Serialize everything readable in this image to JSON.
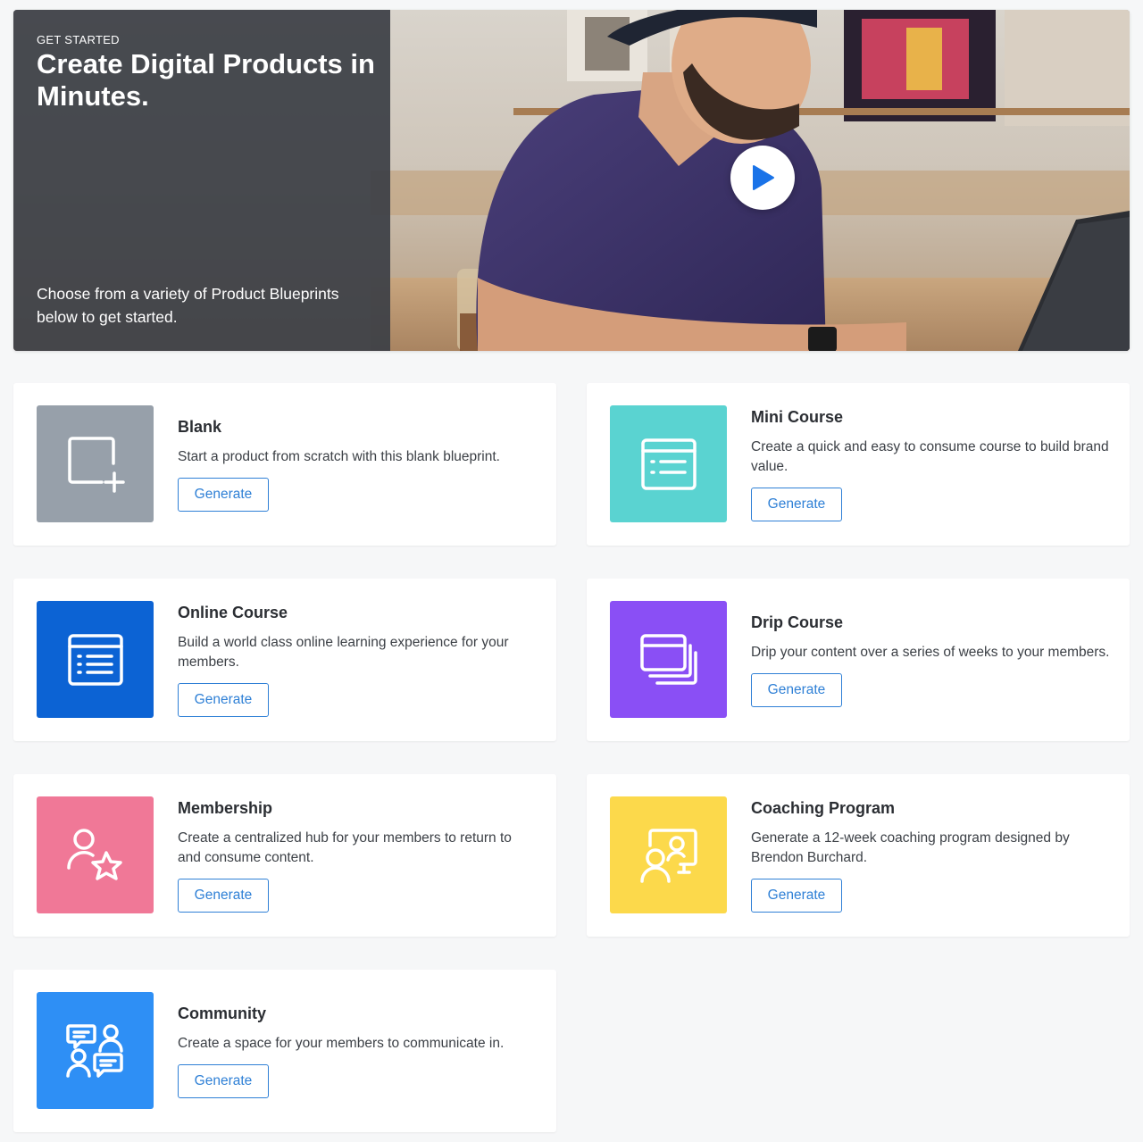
{
  "hero": {
    "eyebrow": "GET STARTED",
    "title": "Create Digital Products in Minutes.",
    "description": "Choose from a variety of Product Blueprints below to get started.",
    "play_icon": "play-icon"
  },
  "cards": [
    {
      "title": "Blank",
      "description": "Start a product from scratch with this blank blueprint.",
      "button_label": "Generate",
      "icon": "blank-square-plus-icon",
      "color": "#97a0aa"
    },
    {
      "title": "Mini Course",
      "description": "Create a quick and easy to consume course to build brand value.",
      "button_label": "Generate",
      "icon": "list-window-icon",
      "color": "#5ad3d1"
    },
    {
      "title": "Online Course",
      "description": "Build a world class online learning experience for your members.",
      "button_label": "Generate",
      "icon": "list-window-icon",
      "color": "#0c63d4"
    },
    {
      "title": "Drip Course",
      "description": "Drip your content over a series of weeks to your members.",
      "button_label": "Generate",
      "icon": "stacked-windows-icon",
      "color": "#8a4ff5"
    },
    {
      "title": "Membership",
      "description": "Create a centralized hub for your members to return to and consume content.",
      "button_label": "Generate",
      "icon": "user-star-icon",
      "color": "#f07897"
    },
    {
      "title": "Coaching Program",
      "description": "Generate a 12-week coaching program designed by Brendon Burchard.",
      "button_label": "Generate",
      "icon": "presenter-screen-icon",
      "color": "#fcd94b"
    },
    {
      "title": "Community",
      "description": "Create a space for your members to communicate in.",
      "button_label": "Generate",
      "icon": "users-chat-icon",
      "color": "#2e8ff5"
    }
  ]
}
